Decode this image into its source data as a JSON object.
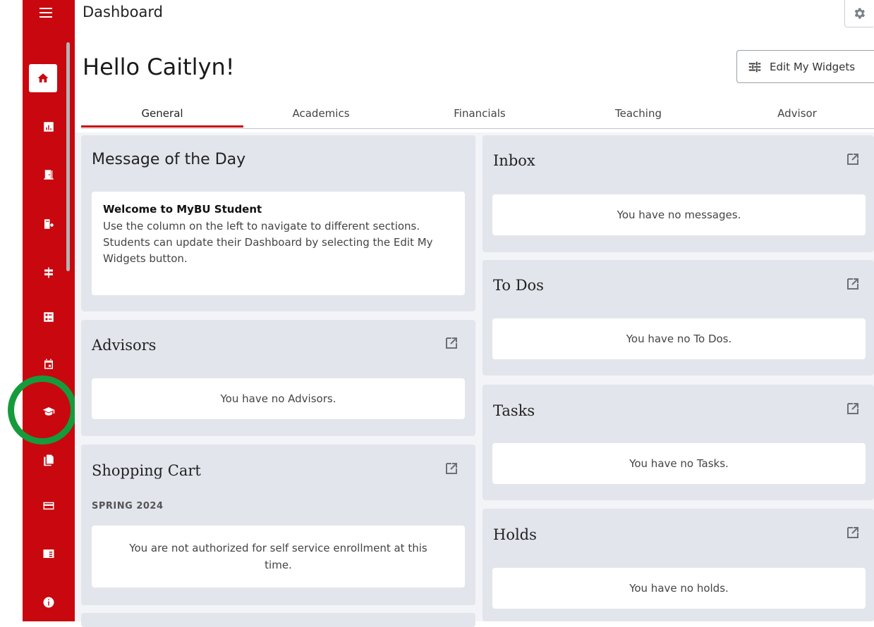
{
  "header": {
    "title": "Dashboard",
    "greeting": "Hello Caitlyn!",
    "edit_widgets_label": "Edit My Widgets"
  },
  "sidebar": {
    "items": [
      {
        "name": "home-icon"
      },
      {
        "name": "chart-icon"
      },
      {
        "name": "door-icon"
      },
      {
        "name": "building-settings-icon"
      },
      {
        "name": "signpost-icon"
      },
      {
        "name": "list-icon"
      },
      {
        "name": "calendar-icon"
      },
      {
        "name": "graduation-cap-icon"
      },
      {
        "name": "documents-icon"
      },
      {
        "name": "credit-card-icon"
      },
      {
        "name": "newspaper-icon"
      },
      {
        "name": "info-icon"
      }
    ],
    "accent_color": "#c8080e",
    "highlight_color": "#159b3c"
  },
  "tabs": [
    {
      "label": "General"
    },
    {
      "label": "Academics"
    },
    {
      "label": "Financials"
    },
    {
      "label": "Teaching"
    },
    {
      "label": "Advisor"
    }
  ],
  "widgets": {
    "motd": {
      "title": "Message of the Day",
      "heading": "Welcome to MyBU Student",
      "body": "Use the column on the left to navigate to different sections. Students can update their Dashboard by selecting the Edit My Widgets button."
    },
    "advisors": {
      "title": "Advisors",
      "message": "You have no Advisors."
    },
    "shopping_cart": {
      "title": "Shopping Cart",
      "term": "SPRING 2024",
      "message": "You are not authorized for self service enrollment at this time."
    },
    "inbox": {
      "title": "Inbox",
      "message": "You have no messages."
    },
    "todos": {
      "title": "To Dos",
      "message": "You have no To Dos."
    },
    "tasks": {
      "title": "Tasks",
      "message": "You have no Tasks."
    },
    "holds": {
      "title": "Holds",
      "message": "You have no holds."
    }
  }
}
